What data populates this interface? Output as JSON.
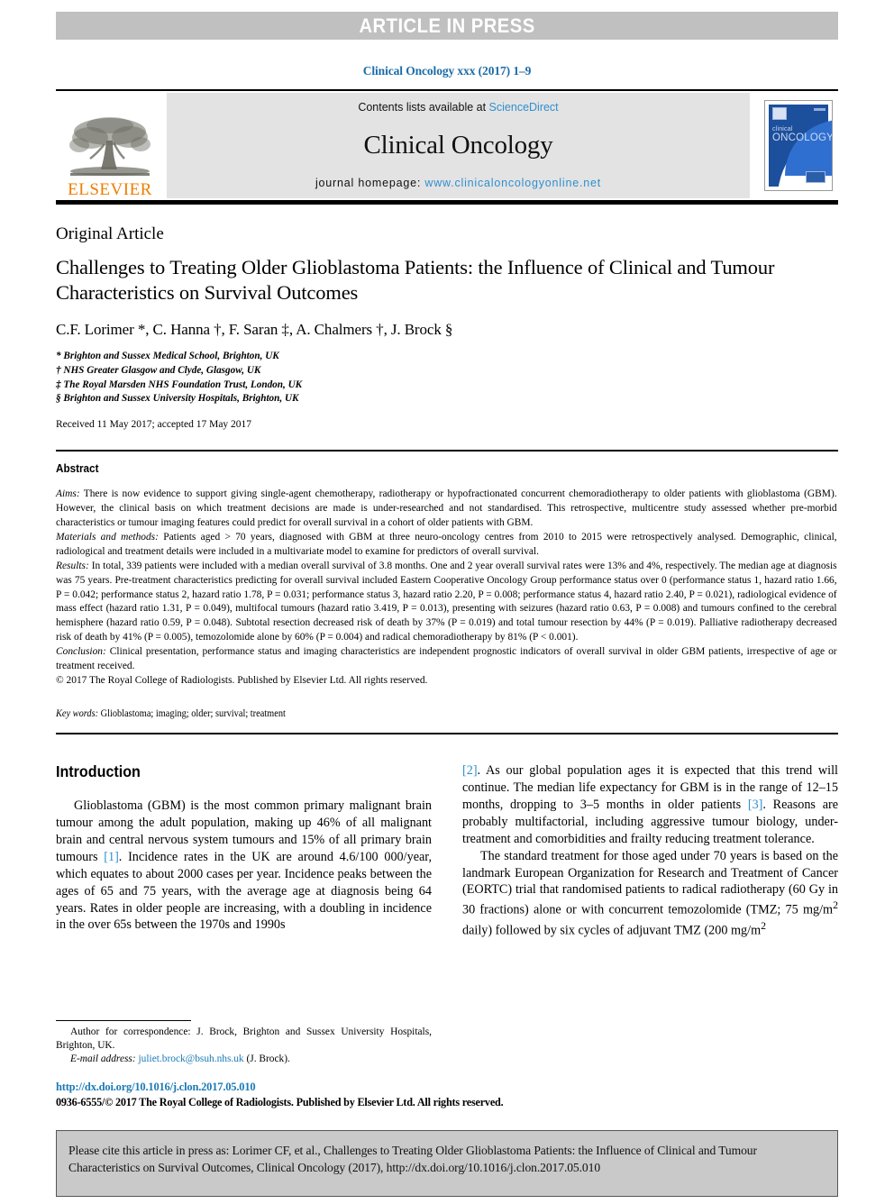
{
  "banner": {
    "text": "ARTICLE IN PRESS"
  },
  "journal_ref": "Clinical Oncology xxx (2017) 1–9",
  "masthead": {
    "publisher": "ELSEVIER",
    "contents_prefix": "Contents lists available at ",
    "contents_link": "ScienceDirect",
    "journal_title": "Clinical Oncology",
    "homepage_prefix": "journal homepage: ",
    "homepage_url": "www.clinicaloncologyonline.net",
    "cover_line1": "clinical",
    "cover_line2": "ONCOLOGY"
  },
  "article": {
    "kicker": "Original Article",
    "title": "Challenges to Treating Older Glioblastoma Patients: the Influence of Clinical and Tumour Characteristics on Survival Outcomes",
    "authors": "C.F. Lorimer *, C. Hanna †, F. Saran ‡, A. Chalmers †, J. Brock §",
    "affiliations": [
      "* Brighton and Sussex Medical School, Brighton, UK",
      "† NHS Greater Glasgow and Clyde, Glasgow, UK",
      "‡ The Royal Marsden NHS Foundation Trust, London, UK",
      "§ Brighton and Sussex University Hospitals, Brighton, UK"
    ],
    "received": "Received 11 May 2017; accepted 17 May 2017"
  },
  "abstract": {
    "heading": "Abstract",
    "aims_label": "Aims:",
    "aims_text": " There is now evidence to support giving single-agent chemotherapy, radiotherapy or hypofractionated concurrent chemoradiotherapy to older patients with glioblastoma (GBM). However, the clinical basis on which treatment decisions are made is under-researched and not standardised. This retrospective, multicentre study assessed whether pre-morbid characteristics or tumour imaging features could predict for overall survival in a cohort of older patients with GBM.",
    "methods_label": "Materials and methods:",
    "methods_text": " Patients aged > 70 years, diagnosed with GBM at three neuro-oncology centres from 2010 to 2015 were retrospectively analysed. Demographic, clinical, radiological and treatment details were included in a multivariate model to examine for predictors of overall survival.",
    "results_label": "Results:",
    "results_text": " In total, 339 patients were included with a median overall survival of 3.8 months. One and 2 year overall survival rates were 13% and 4%, respectively. The median age at diagnosis was 75 years. Pre-treatment characteristics predicting for overall survival included Eastern Cooperative Oncology Group performance status over 0 (performance status 1, hazard ratio 1.66, P = 0.042; performance status 2, hazard ratio 1.78, P = 0.031; performance status 3, hazard ratio 2.20, P = 0.008; performance status 4, hazard ratio 2.40, P = 0.021), radiological evidence of mass effect (hazard ratio 1.31, P = 0.049), multifocal tumours (hazard ratio 3.419, P = 0.013), presenting with seizures (hazard ratio 0.63, P = 0.008) and tumours confined to the cerebral hemisphere (hazard ratio 0.59, P = 0.048). Subtotal resection decreased risk of death by 37% (P = 0.019) and total tumour resection by 44% (P = 0.019). Palliative radiotherapy decreased risk of death by 41% (P = 0.005), temozolomide alone by 60% (P = 0.004) and radical chemoradiotherapy by 81% (P < 0.001).",
    "conclusion_label": "Conclusion:",
    "conclusion_text": " Clinical presentation, performance status and imaging characteristics are independent prognostic indicators of overall survival in older GBM patients, irrespective of age or treatment received.",
    "copyright": "© 2017 The Royal College of Radiologists. Published by Elsevier Ltd. All rights reserved.",
    "keywords_label": "Key words:",
    "keywords_text": " Glioblastoma; imaging; older; survival; treatment"
  },
  "introduction": {
    "heading": "Introduction",
    "p1_a": "Glioblastoma (GBM) is the most common primary malignant brain tumour among the adult population, making up 46% of all malignant brain and central nervous system tumours and 15% of all primary brain tumours ",
    "p1_ref": "[1]",
    "p1_b": ". Incidence rates in the UK are around 4.6/100 000/year, which equates to about 2000 cases per year. Incidence peaks between the ages of 65 and 75 years, with the average age at diagnosis being 64 years. Rates in older people are increasing, with a doubling in incidence in the over 65s between the 1970s and 1990s ",
    "p1_ref2": "[2]",
    "p1_c": ". As our global population ages it is expected that this trend will continue. The median life expectancy for GBM is in the range of 12–15 months, dropping to 3–5 months in older patients ",
    "p1_ref3": "[3]",
    "p1_d": ". Reasons are probably multifactorial, including aggressive tumour biology, under-treatment and comorbidities and frailty reducing treatment tolerance.",
    "p2": "The standard treatment for those aged under 70 years is based on the landmark European Organization for Research and Treatment of Cancer (EORTC) trial that randomised patients to radical radiotherapy (60 Gy in 30 fractions) alone or with concurrent temozolomide (TMZ; 75 mg/m",
    "p2_sup1": "2",
    "p2_b": " daily) followed by six cycles of adjuvant TMZ (200 mg/m",
    "p2_sup2": "2"
  },
  "footnotes": {
    "corr_text": "Author for correspondence: J. Brock, Brighton and Sussex University Hospitals, Brighton, UK.",
    "email_label": "E-mail address:",
    "email_value": " juliet.brock@bsuh.nhs.uk",
    "email_suffix": " (J. Brock).",
    "doi": "http://dx.doi.org/10.1016/j.clon.2017.05.010",
    "issn": "0936-6555/© 2017 The Royal College of Radiologists. Published by Elsevier Ltd. All rights reserved."
  },
  "cite_box": {
    "text": "Please cite this article in press as: Lorimer CF, et al., Challenges to Treating Older Glioblastoma Patients: the Influence of Clinical and Tumour Characteristics on Survival Outcomes, Clinical Oncology (2017), http://dx.doi.org/10.1016/j.clon.2017.05.010"
  },
  "colors": {
    "banner_bg": "#c0c0c0",
    "link_blue": "#2f8fcf",
    "ref_blue": "#1b7ab5",
    "elsevier_orange": "#ef7d00",
    "cover_blue": "#1c4f9c",
    "cite_bg": "#c9c9c9"
  }
}
